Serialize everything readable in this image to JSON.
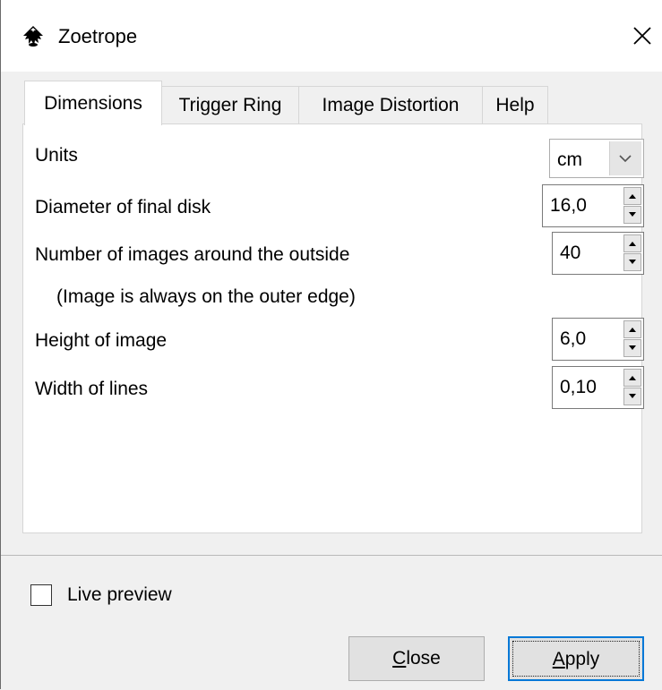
{
  "window": {
    "title": "Zoetrope",
    "app_icon": "inkscape-logo-icon",
    "close_icon": "close-icon"
  },
  "tabs": [
    {
      "label": "Dimensions",
      "active": true
    },
    {
      "label": "Trigger Ring",
      "active": false
    },
    {
      "label": "Image Distortion",
      "active": false
    },
    {
      "label": "Help",
      "active": false
    }
  ],
  "dimensions": {
    "units": {
      "label": "Units",
      "value": "cm"
    },
    "diameter": {
      "label": "Diameter of final disk",
      "value": "16,0"
    },
    "num_images": {
      "label": "Number of images around the outside",
      "value": "40"
    },
    "note": "(Image is always on the outer edge)",
    "height": {
      "label": "Height of image",
      "value": "6,0"
    },
    "line_width": {
      "label": "Width of lines",
      "value": "0,10"
    }
  },
  "footer": {
    "live_preview": {
      "label": "Live preview",
      "checked": false
    },
    "close_button": {
      "mnemonic": "C",
      "rest": "lose"
    },
    "apply_button": {
      "mnemonic": "A",
      "rest": "pply"
    }
  }
}
